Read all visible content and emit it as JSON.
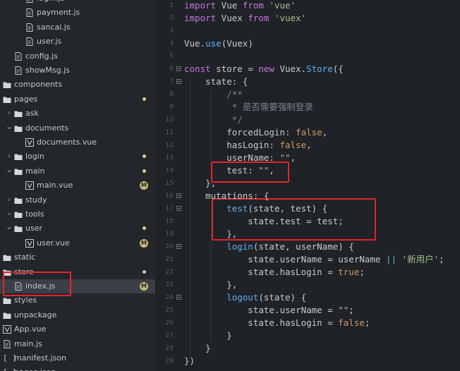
{
  "sidebar": {
    "items": [
      {
        "label": "login.js",
        "type": "file",
        "indent": 2,
        "badge": "dot"
      },
      {
        "label": "payment.js",
        "type": "file",
        "indent": 2
      },
      {
        "label": "sancai.js",
        "type": "file",
        "indent": 2
      },
      {
        "label": "user.js",
        "type": "file",
        "indent": 2
      },
      {
        "label": "config.js",
        "type": "file",
        "indent": 1
      },
      {
        "label": "showMsg.js",
        "type": "file",
        "indent": 1
      },
      {
        "label": "components",
        "type": "folder",
        "indent": 0
      },
      {
        "label": "pages",
        "type": "folder",
        "indent": 0,
        "badge": "dot"
      },
      {
        "label": "ask",
        "type": "folder",
        "indent": 1,
        "arrow": "collapsed"
      },
      {
        "label": "documents",
        "type": "folder",
        "indent": 1,
        "arrow": "expanded"
      },
      {
        "label": "documents.vue",
        "type": "vue",
        "indent": 2
      },
      {
        "label": "login",
        "type": "folder",
        "indent": 1,
        "arrow": "collapsed",
        "badge": "dot"
      },
      {
        "label": "main",
        "type": "folder",
        "indent": 1,
        "arrow": "expanded",
        "badge": "dot"
      },
      {
        "label": "main.vue",
        "type": "vue",
        "indent": 2,
        "badge": "M"
      },
      {
        "label": "study",
        "type": "folder",
        "indent": 1,
        "arrow": "collapsed"
      },
      {
        "label": "tools",
        "type": "folder",
        "indent": 1,
        "arrow": "collapsed"
      },
      {
        "label": "user",
        "type": "folder",
        "indent": 1,
        "arrow": "expanded",
        "badge": "dot"
      },
      {
        "label": "user.vue",
        "type": "vue",
        "indent": 2,
        "badge": "M"
      },
      {
        "label": "static",
        "type": "folder",
        "indent": 0
      },
      {
        "label": "store",
        "type": "folder",
        "indent": 0,
        "badge": "dot"
      },
      {
        "label": "index.js",
        "type": "file",
        "indent": 1,
        "badge": "M",
        "selected": true
      },
      {
        "label": "styles",
        "type": "folder",
        "indent": 0
      },
      {
        "label": "unpackage",
        "type": "folder",
        "indent": 0
      },
      {
        "label": "App.vue",
        "type": "vue",
        "indent": 0
      },
      {
        "label": "main.js",
        "type": "file",
        "indent": 0
      },
      {
        "label": "manifest.json",
        "type": "json",
        "indent": 0
      },
      {
        "label": "pages.json",
        "type": "json",
        "indent": 0
      }
    ],
    "badge_m_text": "M"
  },
  "editor": {
    "lines": [
      {
        "n": "1",
        "tokens": [
          [
            "kw",
            "import"
          ],
          [
            "obj",
            " Vue "
          ],
          [
            "kw",
            "from"
          ],
          [
            "obj",
            " "
          ],
          [
            "str",
            "'vue'"
          ]
        ]
      },
      {
        "n": "2",
        "tokens": [
          [
            "kw",
            "import"
          ],
          [
            "obj",
            " Vuex "
          ],
          [
            "kw",
            "from"
          ],
          [
            "obj",
            " "
          ],
          [
            "str",
            "'vuex'"
          ]
        ]
      },
      {
        "n": "3",
        "tokens": []
      },
      {
        "n": "4",
        "tokens": [
          [
            "obj",
            "Vue."
          ],
          [
            "fn",
            "use"
          ],
          [
            "obj",
            "(Vuex)"
          ]
        ]
      },
      {
        "n": "5",
        "tokens": []
      },
      {
        "n": "6",
        "fold": true,
        "tokens": [
          [
            "kw",
            "const"
          ],
          [
            "obj",
            " store = "
          ],
          [
            "kw",
            "new"
          ],
          [
            "obj",
            " Vuex."
          ],
          [
            "fn",
            "Store"
          ],
          [
            "obj",
            "({"
          ]
        ]
      },
      {
        "n": "7",
        "fold": true,
        "tokens": [
          [
            "obj",
            "    state: {"
          ]
        ]
      },
      {
        "n": "8",
        "tokens": [
          [
            "com",
            "        /**"
          ]
        ]
      },
      {
        "n": "9",
        "tokens": [
          [
            "com",
            "         * 是否需要强制登录"
          ]
        ]
      },
      {
        "n": "10",
        "tokens": [
          [
            "com",
            "         */"
          ]
        ]
      },
      {
        "n": "11",
        "tokens": [
          [
            "obj",
            "        forcedLogin: "
          ],
          [
            "bool",
            "false"
          ],
          [
            "obj",
            ","
          ]
        ]
      },
      {
        "n": "12",
        "tokens": [
          [
            "obj",
            "        hasLogin: "
          ],
          [
            "bool",
            "false"
          ],
          [
            "obj",
            ","
          ]
        ]
      },
      {
        "n": "13",
        "tokens": [
          [
            "obj",
            "        userName: "
          ],
          [
            "str",
            "\"\""
          ],
          [
            "obj",
            ","
          ]
        ]
      },
      {
        "n": "14",
        "tokens": [
          [
            "obj",
            "        test: "
          ],
          [
            "str",
            "\"\""
          ],
          [
            "obj",
            ","
          ]
        ]
      },
      {
        "n": "15",
        "tokens": [
          [
            "obj",
            "    },"
          ]
        ]
      },
      {
        "n": "16",
        "fold": true,
        "tokens": [
          [
            "obj",
            "    mutations: {"
          ]
        ]
      },
      {
        "n": "17",
        "fold": true,
        "tokens": [
          [
            "fn",
            "        test"
          ],
          [
            "obj",
            "(state, test) {"
          ]
        ]
      },
      {
        "n": "18",
        "tokens": [
          [
            "obj",
            "            state.test = test;"
          ]
        ]
      },
      {
        "n": "19",
        "tokens": [
          [
            "obj",
            "        },"
          ]
        ]
      },
      {
        "n": "20",
        "fold": true,
        "tokens": [
          [
            "fn",
            "        login"
          ],
          [
            "obj",
            "(state, userName) {"
          ]
        ]
      },
      {
        "n": "21",
        "tokens": [
          [
            "obj",
            "            state.userName = userName "
          ],
          [
            "op",
            "||"
          ],
          [
            "obj",
            " "
          ],
          [
            "str",
            "'新用户'"
          ],
          [
            "obj",
            ";"
          ]
        ]
      },
      {
        "n": "22",
        "tokens": [
          [
            "obj",
            "            state.hasLogin = "
          ],
          [
            "bool",
            "true"
          ],
          [
            "obj",
            ";"
          ]
        ]
      },
      {
        "n": "23",
        "tokens": [
          [
            "obj",
            "        },"
          ]
        ]
      },
      {
        "n": "24",
        "fold": true,
        "tokens": [
          [
            "fn",
            "        logout"
          ],
          [
            "obj",
            "(state) {"
          ]
        ]
      },
      {
        "n": "25",
        "tokens": [
          [
            "obj",
            "            state.userName = "
          ],
          [
            "str",
            "\"\""
          ],
          [
            "obj",
            ";"
          ]
        ]
      },
      {
        "n": "26",
        "tokens": [
          [
            "obj",
            "            state.hasLogin = "
          ],
          [
            "bool",
            "false"
          ],
          [
            "obj",
            ";"
          ]
        ]
      },
      {
        "n": "27",
        "tokens": [
          [
            "obj",
            "        }"
          ]
        ]
      },
      {
        "n": "28",
        "tokens": [
          [
            "obj",
            "    }"
          ]
        ]
      },
      {
        "n": "29",
        "tokens": [
          [
            "obj",
            "})"
          ]
        ]
      }
    ]
  },
  "colors": {
    "highlight_box": "#e0262a",
    "sidebar_bg": "#23262b",
    "editor_bg": "#1f2227",
    "modified_badge": "#c9b77a"
  }
}
